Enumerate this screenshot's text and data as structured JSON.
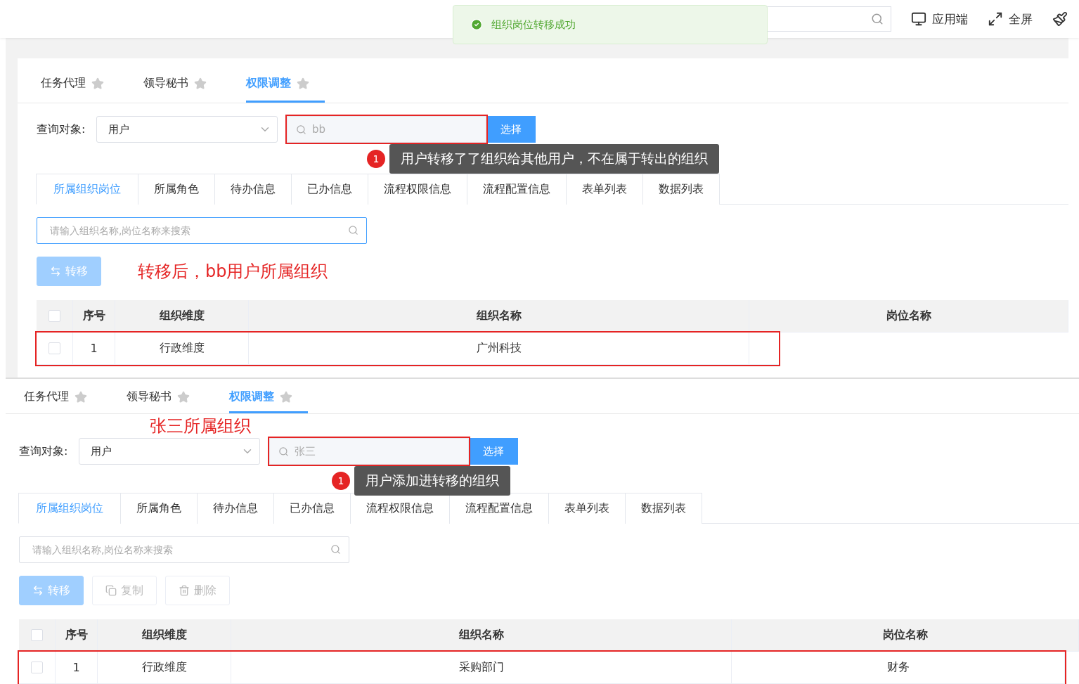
{
  "header": {
    "items": [
      {
        "kind": "monitor",
        "label": "应用端"
      },
      {
        "kind": "fullscreen",
        "label": "全屏"
      },
      {
        "kind": "broom"
      }
    ]
  },
  "toast": {
    "kind": "success",
    "message": "组织岗位转移成功"
  },
  "panels": [
    {
      "page_tabs": [
        {
          "label": "任务代理",
          "selected": false
        },
        {
          "label": "领导秘书",
          "selected": false
        },
        {
          "label": "权限调整",
          "selected": true
        }
      ],
      "query": {
        "label": "查询对象:",
        "select_value": "用户",
        "search_value": "bb",
        "search_highlighted": true,
        "button": "选择"
      },
      "tooltip": {
        "badge": "1",
        "text": "用户转移了了组织给其他用户，不在属于转出的组织"
      },
      "detail_tabs": [
        {
          "label": "所属组织岗位",
          "selected": true
        },
        {
          "label": "所属角色",
          "selected": false
        },
        {
          "label": "待办信息",
          "selected": false
        },
        {
          "label": "已办信息",
          "selected": false
        },
        {
          "label": "流程权限信息",
          "selected": false
        },
        {
          "label": "流程配置信息",
          "selected": false
        },
        {
          "label": "表单列表",
          "selected": false
        },
        {
          "label": "数据列表",
          "selected": false
        }
      ],
      "filter": {
        "placeholder": "请输入组织名称,岗位名称来搜索",
        "focused": true
      },
      "toolbar": {
        "buttons": [
          {
            "kind": "transfer",
            "label": "转移",
            "disabled": true
          }
        ],
        "annotation": "转移后，bb用户所属组织"
      },
      "table": {
        "header_checked": false,
        "columns": [
          "序号",
          "组织维度",
          "组织名称",
          "岗位名称"
        ],
        "rows": [
          {
            "checked": false,
            "highlighted": true,
            "cells": [
              "1",
              "行政维度",
              "广州科技"
            ]
          }
        ]
      }
    },
    {
      "page_tabs": [
        {
          "label": "任务代理",
          "selected": false
        },
        {
          "label": "领导秘书",
          "selected": false
        },
        {
          "label": "权限调整",
          "selected": true
        }
      ],
      "annotation": "张三所属组织",
      "query": {
        "label": "查询对象:",
        "select_value": "用户",
        "search_value": "张三",
        "search_highlighted": true,
        "button": "选择"
      },
      "tooltip": {
        "badge": "1",
        "text": "用户添加进转移的组织"
      },
      "detail_tabs": [
        {
          "label": "所属组织岗位",
          "selected": true
        },
        {
          "label": "所属角色",
          "selected": false
        },
        {
          "label": "待办信息",
          "selected": false
        },
        {
          "label": "已办信息",
          "selected": false
        },
        {
          "label": "流程权限信息",
          "selected": false
        },
        {
          "label": "流程配置信息",
          "selected": false
        },
        {
          "label": "表单列表",
          "selected": false
        },
        {
          "label": "数据列表",
          "selected": false
        }
      ],
      "filter": {
        "placeholder": "请输入组织名称,岗位名称来搜索",
        "focused": false
      },
      "toolbar": {
        "buttons": [
          {
            "kind": "transfer",
            "label": "转移",
            "disabled": true
          },
          {
            "kind": "copy",
            "label": "复制",
            "disabled": true
          },
          {
            "kind": "delete",
            "label": "删除",
            "disabled": true
          }
        ]
      },
      "table": {
        "header_checked": false,
        "columns": [
          "序号",
          "组织维度",
          "组织名称",
          "岗位名称"
        ],
        "rows": [
          {
            "checked": false,
            "highlighted": true,
            "cells": [
              "1",
              "行政维度",
              "采购部门",
              "财务"
            ]
          }
        ]
      }
    }
  ]
}
